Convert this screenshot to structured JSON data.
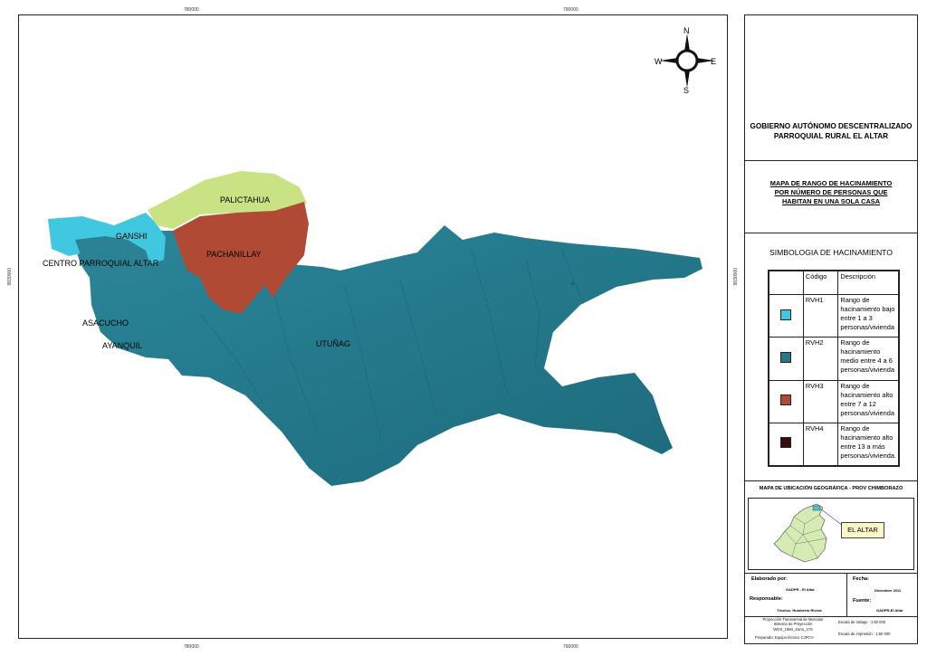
{
  "map": {
    "coords": {
      "top_left": "780000",
      "top_right": "790000",
      "bottom_left": "780000",
      "bottom_right": "790000",
      "left": "9830000",
      "right": "9830000"
    },
    "compass": {
      "n": "N",
      "s": "S",
      "e": "E",
      "w": "W"
    },
    "labels": {
      "palictahua": "PALICTAHUA",
      "ganshi": "GANSHI",
      "pachanillay": "PACHANILLAY",
      "centro": "CENTRO PARROQUIAL ALTAR",
      "asacucho": "ASACUCHO",
      "ayanquil": "AYANQUIL",
      "utunag": "UTUÑAG"
    },
    "colors": {
      "rvh1": "#3fc8e0",
      "rvh2": "#23788a",
      "rvh3": "#b04a35",
      "rvh4": "#3a0c0a",
      "palictahua": "#c9e384"
    }
  },
  "panel": {
    "gov_line1": "GOBIERNO AUTÓNOMO DESCENTRALIZADO",
    "gov_line2": "PARROQUIAL RURAL EL ALTAR",
    "title_line1": "MAPA DE RANGO DE HACINAMIENTO",
    "title_line2": "POR NÚMERO DE PERSONAS QUE",
    "title_line3": "HABITAN EN UNA SOLA CASA",
    "simbologia": "SIMBOLOGIA DE HACINAMIENTO",
    "legend": {
      "col_code": "Código",
      "col_desc": "Descripción",
      "rows": [
        {
          "code": "RVH1",
          "desc": "Rango de hacinamiento bajo entre 1 a 3 personas/vivienda",
          "color": "#3fc8e0"
        },
        {
          "code": "RVH2",
          "desc": "Rango de hacinamiento medio entre 4 a 6 personas/vivienda",
          "color": "#23788a"
        },
        {
          "code": "RVH3",
          "desc": "Rango de hacinamiento alto entre 7 a  12 personas/vivienda",
          "color": "#b04a35"
        },
        {
          "code": "RVH4",
          "desc": "Rango de hacinamiento alto entre 13 a más personas/vivienda.",
          "color": "#3a0c0a"
        }
      ]
    },
    "location_title": "MAPA DE UBICACIÓN GEOGRÁFICA - PROV CHIMBORAZO",
    "callout": "EL ALTAR",
    "elaborado_label": "Elaborado por:",
    "elaborado_val": "GADPR - El Altar",
    "fecha_label": "Fecha:",
    "fecha_val": "Diciembre  2011",
    "responsable_label": "Responsable:",
    "responsable_val": "Técnico. Humberto Rivera",
    "fuente_label": "Fuente:",
    "fuente_val": "GADPR-El Altar",
    "proj1": "Proyección Transversal de Mercator",
    "proj2": "Sistema de Proyección",
    "proj3": "WGS_1984_Zona_17S",
    "preparado": "Preparado: Equipo técnico CJPCH",
    "escala1": "Escala de trabajo : 1:50 000",
    "escala2": "Escala  de impresión : 1:50 000"
  }
}
